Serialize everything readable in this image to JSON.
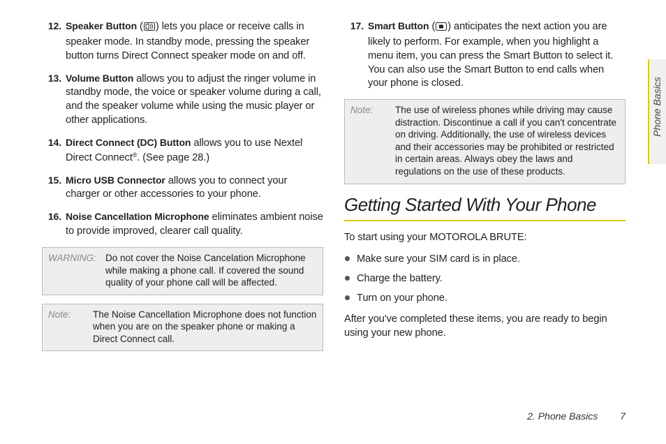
{
  "left": {
    "items": [
      {
        "n": "12.",
        "label": "Speaker Button",
        "suffix": "(",
        "icon": "speaker-icon",
        "after": ") lets you place or receive calls in speaker mode. In standby mode, pressing the speaker button turns Direct Connect speaker mode on and off."
      },
      {
        "n": "13.",
        "label": "Volume Button",
        "after": " allows you to adjust the ringer volume in standby mode, the voice or speaker volume during a call, and the speaker volume while using the music player or other applications."
      },
      {
        "n": "14.",
        "label": "Direct Connect (DC) Button",
        "after": " allows you to use Nextel Direct Connect",
        "reg": "®",
        "after2": ". (See page 28.)"
      },
      {
        "n": "15.",
        "label": "Micro USB Connector",
        "after": " allows you to connect your charger or other accessories to your phone."
      },
      {
        "n": "16.",
        "label": "Noise Cancellation Microphone",
        "after": " eliminates ambient noise to provide improved, clearer call quality."
      }
    ],
    "warning": {
      "label": "WARNING:",
      "text": "Do not cover the Noise Cancelation Microphone while making a phone call.  If covered the sound quality of your phone call will be affected."
    },
    "note": {
      "label": "Note:",
      "text": "The Noise Cancellation Microphone does not function when you are on the speaker phone or making a Direct Connect call."
    }
  },
  "right": {
    "item17": {
      "n": "17.",
      "label": "Smart Button",
      "suffix": "(",
      "icon": "smart-icon",
      "after": ") anticipates the next action you are likely to perform. For example, when you highlight a menu item, you can press the Smart Button to select it. You can also use the Smart Button to end calls when your phone is closed."
    },
    "note": {
      "label": "Note:",
      "text": "The use of wireless phones while driving may cause distraction. Discontinue a call if you can't concentrate on driving. Additionally, the use of wireless devices and their accessories may be prohibited or restricted in certain areas. Always obey the laws and regulations on the use of these products."
    },
    "heading": "Getting Started With Your Phone",
    "intro": "To start using your MOTOROLA BRUTE:",
    "bullets": [
      "Make sure your SIM card is in place.",
      "Charge the battery.",
      "Turn on your phone."
    ],
    "outro": "After you've completed these items, you are ready to begin using your new phone."
  },
  "sidetab": "Phone Basics",
  "footer": {
    "chapter": "2. Phone Basics",
    "page": "7"
  }
}
